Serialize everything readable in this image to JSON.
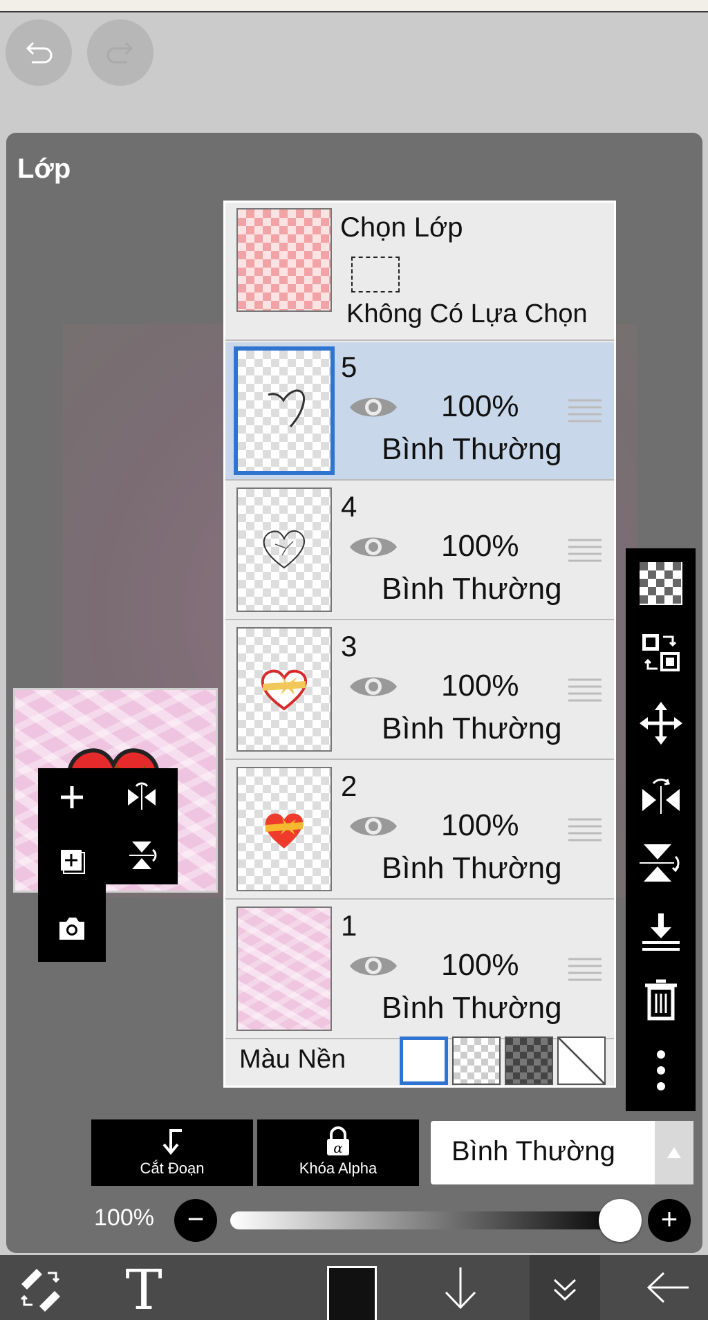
{
  "panel": {
    "title": "Lớp"
  },
  "selection_layer": {
    "title": "Chọn Lớp",
    "subtitle": "Không Có Lựa Chọn"
  },
  "layers": [
    {
      "number": "5",
      "opacity": "100%",
      "mode": "Bình Thường",
      "active": true,
      "thumb": "heart-outline"
    },
    {
      "number": "4",
      "opacity": "100%",
      "mode": "Bình Thường",
      "active": false,
      "thumb": "heart-sketch"
    },
    {
      "number": "3",
      "opacity": "100%",
      "mode": "Bình Thường",
      "active": false,
      "thumb": "heart-ribbon"
    },
    {
      "number": "2",
      "opacity": "100%",
      "mode": "Bình Thường",
      "active": false,
      "thumb": "heart-fill"
    },
    {
      "number": "1",
      "opacity": "100%",
      "mode": "Bình Thường",
      "active": false,
      "thumb": "pink-texture"
    }
  ],
  "background": {
    "label": "Màu Nền",
    "options": [
      "white",
      "checker",
      "dark-checker",
      "none"
    ],
    "selected": "white"
  },
  "actions": {
    "clipping_label": "Cắt Đoạn",
    "alpha_lock_label": "Khóa Alpha"
  },
  "blend_mode": {
    "value": "Bình Thường"
  },
  "opacity": {
    "label": "100%",
    "value": 1.0
  },
  "colors": {
    "accent": "#2f74d0",
    "panel": "#6f6f6f",
    "active_row": "#c9d7ea",
    "current_color": "#111111"
  }
}
